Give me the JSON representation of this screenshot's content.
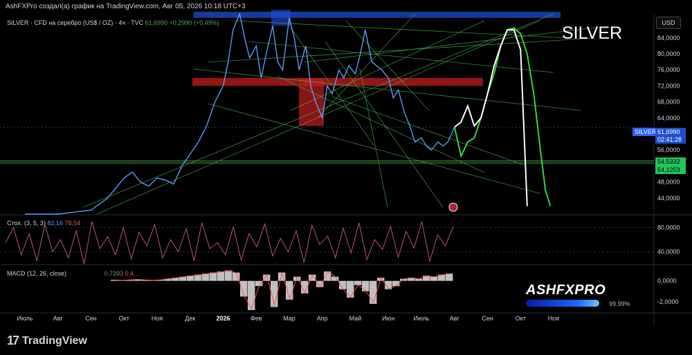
{
  "header": {
    "caption": "AshFXPro создал(а) график на TradingView.com, Авг 05, 2026 10:18 UTC+3"
  },
  "symbol_legend": {
    "name": "SILVER · CFD на серебро (US$ / OZ) · 4ч · TVC",
    "last": "61,6990",
    "change": "+0,2990 (+0,49%)"
  },
  "stoch_legend": {
    "name": "Стох. (3, 5, 3)",
    "k": "82,16",
    "d": "78,54"
  },
  "macd_legend": {
    "name": "MACD (12, 26, close)",
    "macd": "0,7393",
    "signal": "0,4..."
  },
  "annotation_title": "SILVER",
  "currency_button": "USD",
  "price_tags": {
    "silver_label": "SILVER",
    "silver_price": "61,6990",
    "countdown": "02:41:28",
    "green_1": "54,5332",
    "green_2": "54,1253"
  },
  "branding": {
    "name": "ASHFXPRO",
    "percent": "99.99%"
  },
  "footer": {
    "logo_text": "TradingView"
  },
  "colors": {
    "price_line": "#5b9cf6",
    "trend_green": "#4caf50",
    "projection_green": "#3fd13f",
    "projection_white": "#ffffff",
    "resistance_red": "#b71c1c",
    "top_zone_blue": "#1e4fd6",
    "stoch_line": "#c0508a",
    "macd_hist": "#c0c0c0",
    "macd_line": "#ff4d4d"
  },
  "chart_data": [
    {
      "type": "line",
      "ylim": [
        40,
        90
      ],
      "yticks": [
        "84,0000",
        "80,0000",
        "76,0000",
        "72,0000",
        "68,0000",
        "64,0000",
        "56,0000",
        "48,0000",
        "44,0000"
      ],
      "ytick_values": [
        84,
        80,
        76,
        72,
        68,
        64,
        56,
        48,
        44
      ],
      "xticks": [
        "Июль",
        "Авг",
        "Сен",
        "Окт",
        "Ноя",
        "Дек",
        "2026",
        "Фев",
        "Мар",
        "Апр",
        "Май",
        "Июн",
        "Июль",
        "Авг",
        "Сен",
        "Окт",
        "Ноя"
      ],
      "xtick_index": [
        0,
        2,
        4,
        6,
        8,
        10,
        12,
        14,
        16,
        18,
        20,
        22,
        24,
        26,
        28,
        30,
        32
      ],
      "series": [
        {
          "x": [
            0,
            1,
            2,
            3,
            4,
            5,
            6,
            6.5,
            7,
            7.5,
            8,
            8.5,
            9,
            9.5,
            10,
            10.5,
            11,
            11.5,
            12,
            12.3,
            12.6,
            13,
            13.3,
            13.6,
            14,
            14.3,
            14.6,
            15,
            15.3,
            15.6,
            16,
            16.3,
            16.6,
            17,
            17.3,
            17.6,
            18,
            18.3,
            18.6,
            19,
            19.3,
            19.6,
            20,
            20.3,
            20.6,
            21,
            21.3,
            21.6,
            22,
            22.3,
            22.6,
            23,
            23.3,
            23.6,
            24,
            24.3,
            24.6,
            25,
            25.3,
            25.6,
            26
          ],
          "y": [
            40,
            40,
            40,
            40.5,
            41,
            44,
            49,
            50.5,
            48,
            47,
            49,
            48.5,
            47.5,
            52,
            55,
            58,
            62,
            68,
            72,
            78,
            86,
            90,
            84,
            79,
            82,
            74,
            80,
            87,
            78,
            76,
            89,
            84,
            76,
            82,
            72,
            68,
            64,
            72,
            70,
            76,
            74,
            77,
            75,
            80,
            86,
            78,
            77,
            76,
            74,
            69,
            71,
            65,
            62,
            58,
            59,
            57,
            56,
            58,
            57,
            58,
            61.7
          ]
        }
      ],
      "projections": [
        {
          "name": "",
          "x": [
            26,
            26.4,
            26.8,
            27.2,
            27.6,
            28,
            28.4,
            28.8,
            29.2,
            29.6,
            30,
            30.4,
            30.8,
            31.2,
            31.5,
            31.8
          ],
          "y": [
            61.7,
            54.5,
            58,
            59,
            64,
            70,
            75,
            82,
            86,
            86.5,
            85,
            80,
            70,
            56,
            46,
            42
          ]
        },
        {
          "name": "",
          "x": [
            26,
            26.4,
            26.8,
            27.2,
            27.6,
            28,
            28.4,
            28.8,
            29.2,
            29.6,
            30,
            30.4
          ],
          "y": [
            61.7,
            63,
            67,
            62,
            64,
            70,
            77,
            82,
            86,
            86,
            81,
            42
          ]
        }
      ]
    },
    {
      "type": "line",
      "ylim": [
        20,
        100
      ],
      "yticks": [
        "80,0000",
        "40,0000"
      ],
      "ytick_values": [
        80,
        40
      ],
      "series": [
        {
          "name": "Стох. (3, 5, 3)",
          "values": [
            55,
            80,
            35,
            70,
            25,
            85,
            40,
            60,
            30,
            75,
            20,
            90,
            45,
            65,
            35,
            80,
            28,
            72,
            50,
            85,
            30,
            60,
            40,
            78,
            25,
            88,
            45,
            55,
            35,
            82,
            26,
            70,
            48,
            86,
            33,
            62,
            40,
            75,
            22,
            84,
            52,
            66,
            30,
            79,
            38,
            88,
            27,
            60,
            44,
            82,
            31,
            74,
            46,
            90,
            24,
            68,
            50,
            82
          ]
        }
      ]
    },
    {
      "type": "bar",
      "ylim": [
        -3,
        1.5
      ],
      "yticks": [
        "0,0000",
        "-2,0000"
      ],
      "ytick_values": [
        0,
        -2
      ],
      "series": [
        {
          "name": "MACD (12, 26, close)",
          "values": [
            0.1,
            0.05,
            0.1,
            0.15,
            0.1,
            0.05,
            0.1,
            0.2,
            0.3,
            0.4,
            0.5,
            0.6,
            0.7,
            0.8,
            0.9,
            1.0,
            0.8,
            -1.5,
            -2.8,
            -0.5,
            0.6,
            -2.5,
            0.8,
            -1.8,
            0.4,
            -1.2,
            0.6,
            -0.6,
            0.9,
            0.4,
            -0.8,
            -1.6,
            -0.4,
            -1.0,
            -2.2,
            0.3,
            -0.8,
            -0.5,
            0.2,
            0.3,
            0.2,
            0.5,
            0.4,
            0.6,
            0.7
          ]
        }
      ]
    }
  ]
}
